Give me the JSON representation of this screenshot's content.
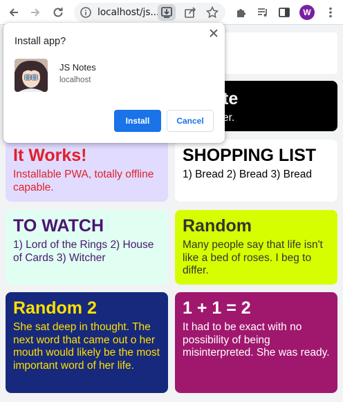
{
  "browser": {
    "url": "localhost/js...",
    "profile_initial": "W",
    "icons": [
      "back-icon",
      "forward-icon",
      "reload-icon",
      "info-icon",
      "install-app-icon",
      "share-icon",
      "star-icon",
      "extensions-icon",
      "media-icon",
      "side-panel-icon",
      "more-vert-icon"
    ]
  },
  "install_dialog": {
    "title": "Install app?",
    "app_name": "JS Notes",
    "origin": "localhost",
    "install_label": "Install",
    "cancel_label": "Cancel"
  },
  "page": {
    "partial_card": {
      "title_fragment": "te",
      "body_fragment": "er."
    },
    "notes": [
      {
        "title": "It Works!",
        "body": "Installable PWA, totally offline capable.",
        "bg": "#e1dbff",
        "color": "#e0202c"
      },
      {
        "title": "SHOPPING LIST",
        "body": "1) Bread 2) Bread 3) Bread",
        "bg": "#ffffff",
        "color": "#000000"
      },
      {
        "title": "TO WATCH",
        "body": "1) Lord of the Rings 2) House of Cards 3) Witcher",
        "bg": "#e0fff2",
        "color": "#4a1470"
      },
      {
        "title": "Random",
        "body": "Many people say that life isn't like a bed of roses. I beg to differ.",
        "bg": "#d7fe00",
        "color": "#333333"
      },
      {
        "title": "Random 2",
        "body": "She sat deep in thought. The next word that came out o her mouth would likely be the most important word of her life.",
        "bg": "#16297d",
        "color": "#ffe000"
      },
      {
        "title": "1 + 1 = 2",
        "body": "It had to be exact with no possibility of being misinterpreted. She was ready.",
        "bg": "#a0176e",
        "color": "#ffffff"
      }
    ]
  }
}
